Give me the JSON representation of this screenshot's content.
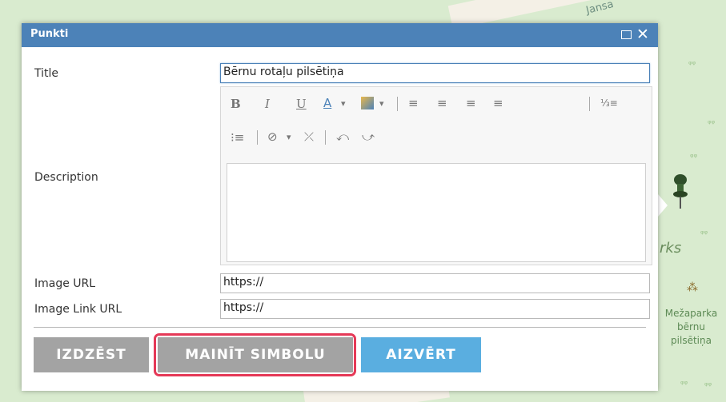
{
  "map": {
    "road_label": "Jansa",
    "park_partial_label": "rks",
    "poi_label_lines": [
      "Mežaparka",
      "bērnu",
      "pilsētiņa"
    ],
    "colors": {
      "background": "#d9ebcf",
      "road": "#f4f0e6"
    }
  },
  "popup": {
    "title": "Punkti",
    "maximize_icon": "maximize-icon",
    "close_icon": "close-icon",
    "fields": {
      "title": {
        "label": "Title",
        "value": "Bērnu rotaļu pilsētiņa"
      },
      "description": {
        "label": "Description",
        "value": ""
      },
      "image_url": {
        "label": "Image URL",
        "value": "https://"
      },
      "image_link_url": {
        "label": "Image Link URL",
        "value": "https://"
      }
    },
    "toolbar": {
      "bold": "B",
      "italic": "I",
      "underline": "U",
      "font_color": "A",
      "dropdown": "▾",
      "bullet": "⁝≡",
      "undo": "⤺",
      "redo": "⤻"
    },
    "buttons": {
      "delete": "IZDZĒST",
      "change_symbol": "MAINĪT SIMBOLU",
      "close": "AIZVĒRT"
    },
    "colors": {
      "titlebar": "#4c82b8",
      "button_gray": "#a3a3a3",
      "button_blue": "#5aaee0",
      "highlight": "#e53957"
    }
  }
}
